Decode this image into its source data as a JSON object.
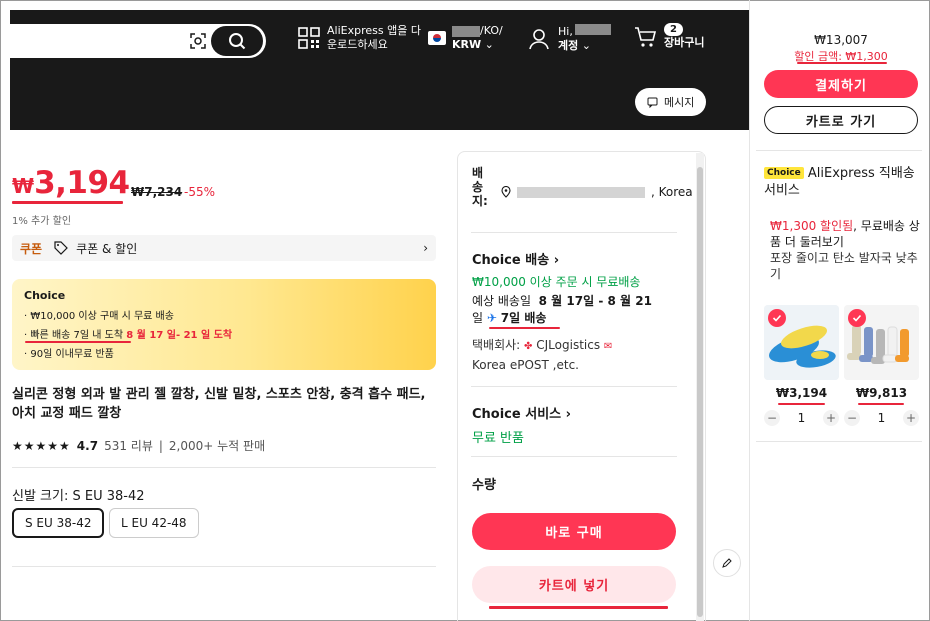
{
  "header": {
    "app_download": "AliExpress 앱을 다운로드하세요",
    "locale_suffix": "/KO/",
    "currency": "KRW",
    "greeting": "Hi,",
    "account_label": "계정",
    "cart_count": "2",
    "cart_label": "장바구니",
    "message_button": "메시지"
  },
  "product": {
    "currency_symbol": "₩",
    "price": "3,194",
    "original_price": "₩7,234",
    "discount_percent": "-55%",
    "extra_discount": "1% 추가 할인",
    "coupon_tag": "쿠폰",
    "coupon_label": "쿠폰 & 할인",
    "choice_title": "Choice",
    "choice_line1": "₩10,000 이상 구매 시 무료 배송",
    "choice_line2_a": "빠른 배송 7일 내 도착",
    "choice_line2_b": "8 월 17 일- 21 일 도착",
    "choice_line3": "90일 이내무료 반품",
    "title": "실리콘 정형 외과 발 관리 젤 깔창, 신발 밑창, 스포츠 안창, 충격 흡수 패드, 아치 교정 패드 깔창",
    "stars": "★★★★★",
    "rating": "4.7",
    "reviews": "531 리뷰",
    "sold": "2,000+ 누적 판매",
    "size_label": "신발 크기: S EU 38-42",
    "sizes": [
      "S EU 38-42",
      "L EU 42-48"
    ]
  },
  "delivery": {
    "ship_to": [
      "배",
      "송",
      "지:"
    ],
    "country": ", Korea",
    "choice_shipping_title": "Choice 배송",
    "free_shipping": "₩10,000 이상 주문 시 무료배송",
    "eta_prefix": "예상 배송일",
    "eta_dates": "8 월 17일 - 8 월 21",
    "eta_suffix": "일",
    "eta_days": "7일 배송",
    "carrier_label": "택배회사:",
    "carrier_name": "CJLogistics",
    "carrier_more": "Korea ePOST ,etc.",
    "choice_service_title": "Choice 서비스",
    "free_return": "무료 반품",
    "quantity_label": "수량",
    "buy_now": "바로 구매",
    "add_to_cart": "카트에 넣기"
  },
  "cart_panel": {
    "total": "₩13,007",
    "discount": "할인 금액: ₩1,300",
    "checkout": "결제하기",
    "go_to_cart": "카트로 가기",
    "choice_tag": "Choice",
    "choice_title": "AliExpress 직배송 서비스",
    "promo_red": "₩1,300 할인됨",
    "promo_rest": ", 무료배송 상품 더 둘러보기",
    "promo_sub": "포장 줄이고 탄소 발자국 낮추기",
    "items": [
      {
        "price": "₩3,194",
        "qty": "1"
      },
      {
        "price": "₩9,813",
        "qty": "1"
      }
    ]
  },
  "colors": {
    "accent": "#ff3654",
    "price_red": "#e8253b",
    "header_bg": "#191919",
    "choice_yellow": "#ffe53b",
    "green": "#00a046"
  }
}
